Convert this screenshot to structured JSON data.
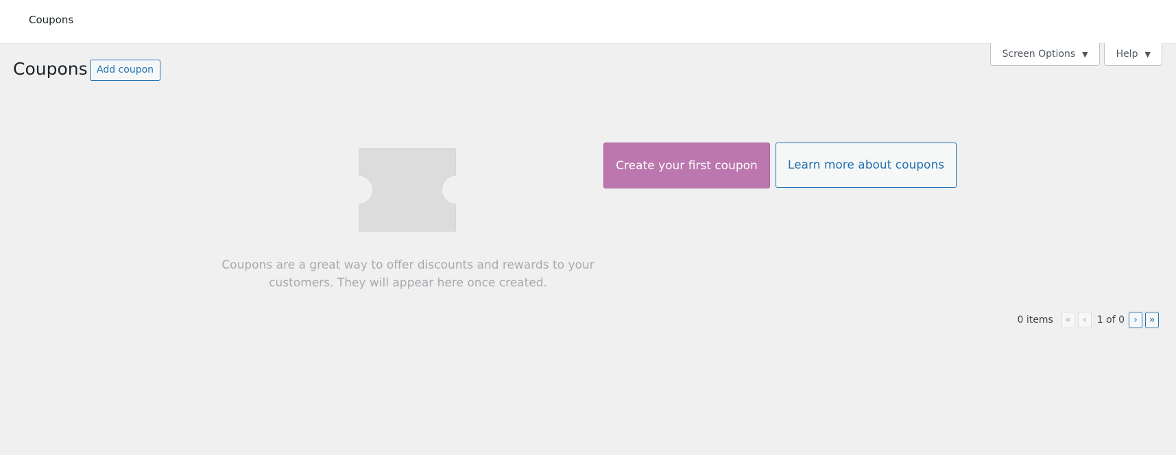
{
  "header": {
    "title": "Coupons"
  },
  "screen_meta": {
    "screen_options_label": "Screen Options",
    "help_label": "Help"
  },
  "page": {
    "title": "Coupons",
    "add_button_label": "Add coupon"
  },
  "empty_state": {
    "icon": "coupon-ticket-icon",
    "message_line1": "Coupons are a great way to offer discounts and rewards to your",
    "message_line2": "customers. They will appear here once created.",
    "primary_cta_label": "Create your first coupon",
    "secondary_cta_label": "Learn more about coupons"
  },
  "pagination": {
    "items_count": "0 items",
    "first_label": "«",
    "prev_label": "‹",
    "page_text": "1 of 0",
    "next_label": "›",
    "last_label": "»"
  },
  "colors": {
    "background": "#f0f0f1",
    "accent": "#2271b1",
    "primary_cta": "#bb77ae",
    "muted_text": "#a7aaad"
  }
}
